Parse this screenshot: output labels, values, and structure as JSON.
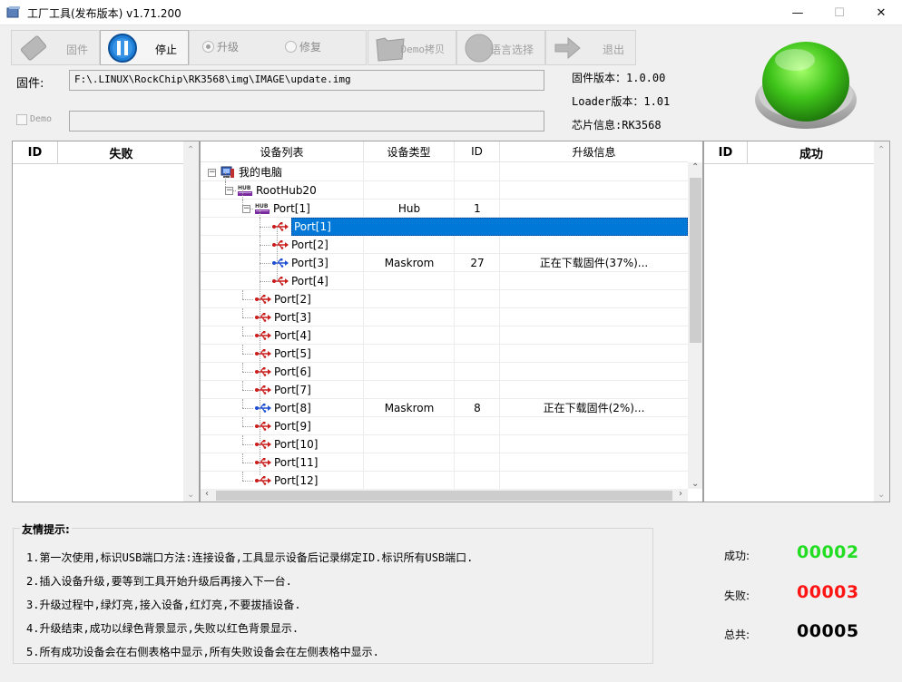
{
  "window": {
    "title": "工厂工具(发布版本) v1.71.200",
    "minimize_label": "—",
    "maximize_label": "☐",
    "close_label": "✕"
  },
  "toolbar": {
    "firmware_label": "固件",
    "stop_label": "停止",
    "upgrade_radio_label": "升级",
    "repair_radio_label": "修复",
    "demo_copy_label": "Demo拷贝",
    "language_label": "语言选择",
    "exit_label": "退出",
    "selected_mode": "升级"
  },
  "firmware": {
    "label": "固件:",
    "path": "F:\\.LINUX\\RockChip\\RK3568\\img\\IMAGE\\update.img"
  },
  "demo": {
    "label": "Demo",
    "checked": false,
    "value": ""
  },
  "info": {
    "firmware_version": "固件版本：1.0.00",
    "loader_version": "Loader版本：1.01",
    "chip_info": "芯片信息:RK3568"
  },
  "status_light_color": "#3fc41a",
  "fail_table": {
    "id_header": "ID",
    "title": "失败",
    "rows": []
  },
  "success_table": {
    "id_header": "ID",
    "title": "成功",
    "rows": []
  },
  "device_tree": {
    "headers": {
      "device_list": "设备列表",
      "device_type": "设备类型",
      "id": "ID",
      "upgrade_info": "升级信息"
    },
    "rows": [
      {
        "name": "我的电脑",
        "type": "",
        "id": "",
        "info": ""
      },
      {
        "name": "RootHub20",
        "type": "",
        "id": "",
        "info": ""
      },
      {
        "name": "Port[1]",
        "type": "Hub",
        "id": "1",
        "info": ""
      },
      {
        "name": "Port[1]",
        "type": "",
        "id": "",
        "info": ""
      },
      {
        "name": "Port[2]",
        "type": "",
        "id": "",
        "info": ""
      },
      {
        "name": "Port[3]",
        "type": "Maskrom",
        "id": "27",
        "info": "正在下载固件(37%)..."
      },
      {
        "name": "Port[4]",
        "type": "",
        "id": "",
        "info": ""
      },
      {
        "name": "Port[2]",
        "type": "",
        "id": "",
        "info": ""
      },
      {
        "name": "Port[3]",
        "type": "",
        "id": "",
        "info": ""
      },
      {
        "name": "Port[4]",
        "type": "",
        "id": "",
        "info": ""
      },
      {
        "name": "Port[5]",
        "type": "",
        "id": "",
        "info": ""
      },
      {
        "name": "Port[6]",
        "type": "",
        "id": "",
        "info": ""
      },
      {
        "name": "Port[7]",
        "type": "",
        "id": "",
        "info": ""
      },
      {
        "name": "Port[8]",
        "type": "Maskrom",
        "id": "8",
        "info": "正在下载固件(2%)..."
      },
      {
        "name": "Port[9]",
        "type": "",
        "id": "",
        "info": ""
      },
      {
        "name": "Port[10]",
        "type": "",
        "id": "",
        "info": ""
      },
      {
        "name": "Port[11]",
        "type": "",
        "id": "",
        "info": ""
      },
      {
        "name": "Port[12]",
        "type": "",
        "id": "",
        "info": ""
      }
    ],
    "selected_row": 3
  },
  "tips": {
    "title": "友情提示:",
    "items": [
      "1.第一次使用,标识USB端口方法:连接设备,工具显示设备后记录绑定ID.标识所有USB端口.",
      "2.插入设备升级,要等到工具开始升级后再接入下一台.",
      "3.升级过程中,绿灯亮,接入设备,红灯亮,不要拔插设备.",
      "4.升级结束,成功以绿色背景显示,失败以红色背景显示.",
      "5.所有成功设备会在右侧表格中显示,所有失败设备会在左侧表格中显示."
    ]
  },
  "counters": {
    "success_label": "成功:",
    "success_value": "00002",
    "fail_label": "失败:",
    "fail_value": "00003",
    "total_label": "总共:",
    "total_value": "00005",
    "success_color": "#22dd22",
    "fail_color": "#ff1414"
  }
}
